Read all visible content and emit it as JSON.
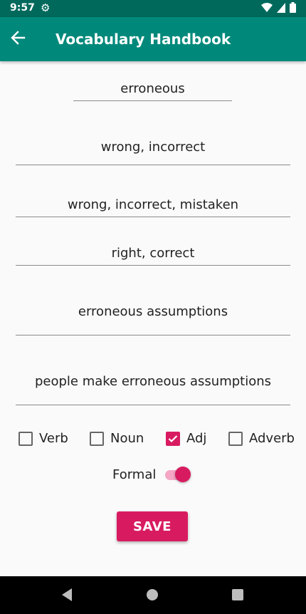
{
  "status_bar": {
    "time": "9:57",
    "icons": [
      "gear-icon",
      "wifi-icon",
      "signal-icon",
      "battery-icon"
    ]
  },
  "app_bar": {
    "title": "Vocabulary Handbook",
    "back_icon": "arrow-back-icon",
    "color": "#00897b"
  },
  "form": {
    "word": "erroneous",
    "meaning": "wrong, incorrect",
    "synonyms": "wrong, incorrect, mistaken",
    "antonyms": "right, correct",
    "phrase": "erroneous assumptions",
    "example": "people make erroneous assumptions"
  },
  "word_types": [
    {
      "label": "Verb",
      "checked": false
    },
    {
      "label": "Noun",
      "checked": false
    },
    {
      "label": "Adj",
      "checked": true
    },
    {
      "label": "Adverb",
      "checked": false
    }
  ],
  "formal": {
    "label": "Formal",
    "on": true
  },
  "save_label": "SAVE",
  "accent_color": "#d81b60"
}
